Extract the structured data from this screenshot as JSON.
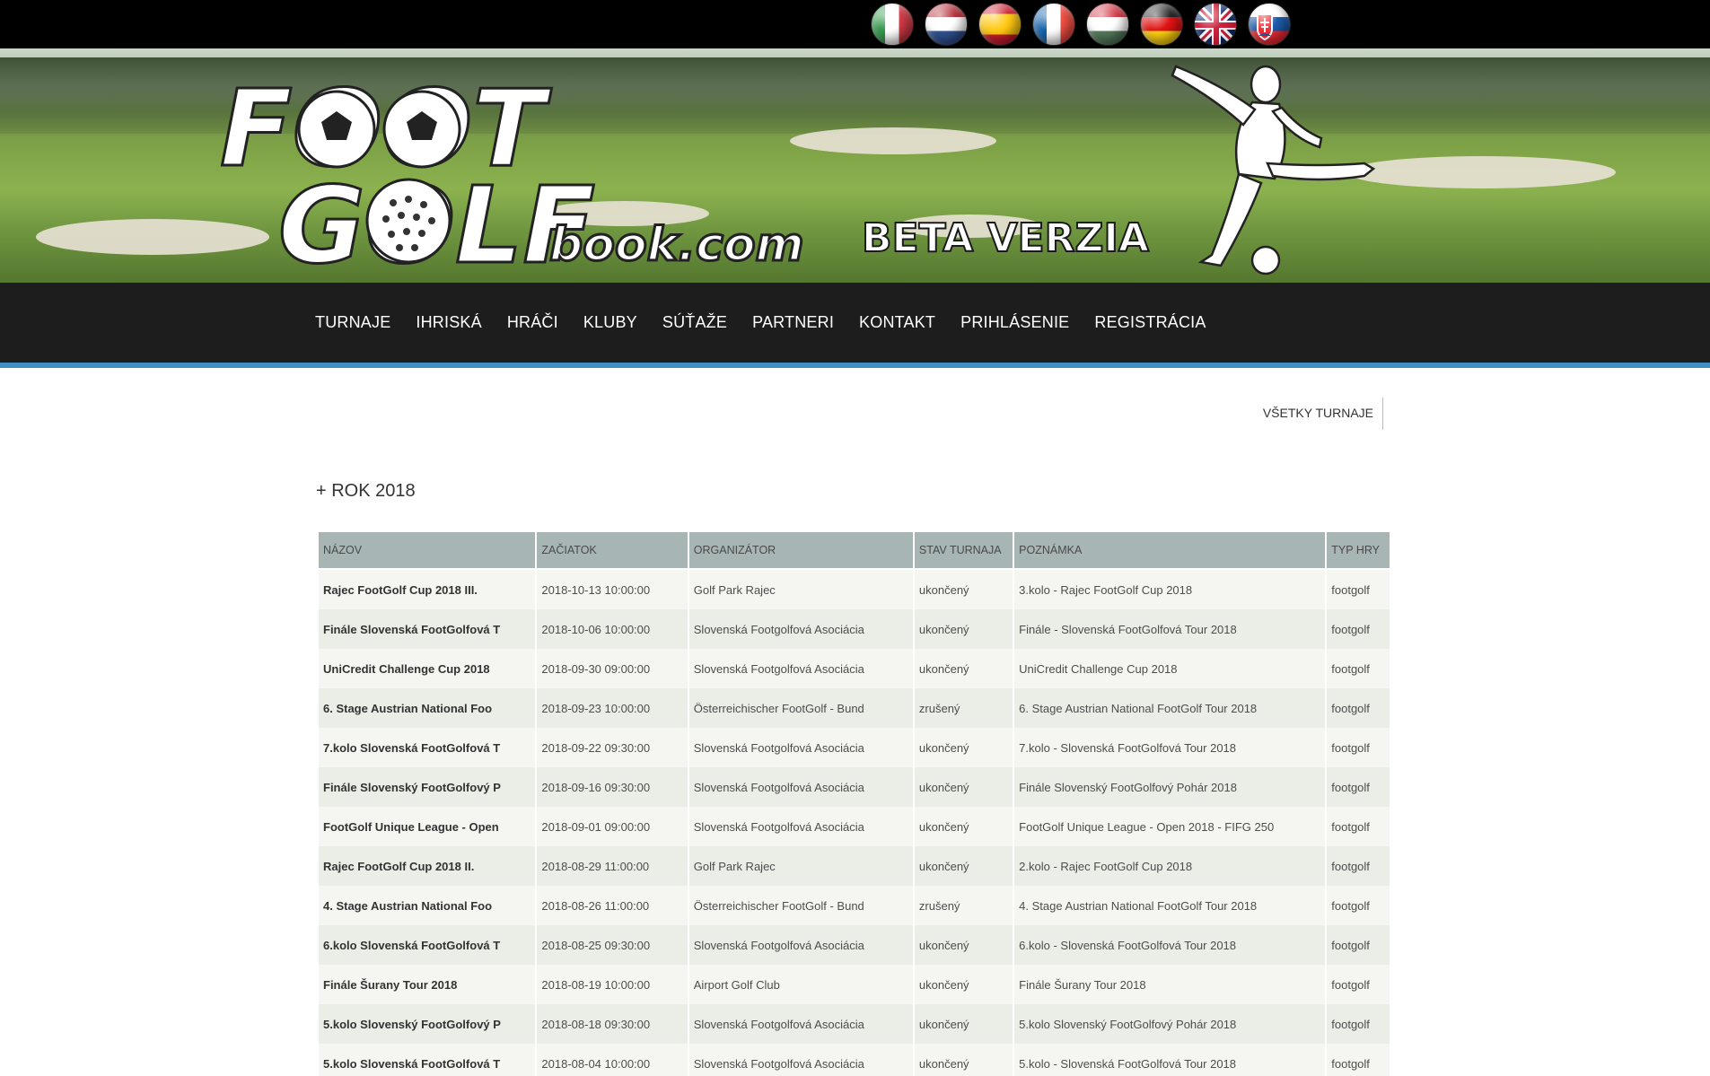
{
  "header": {
    "languages": [
      {
        "code": "it",
        "icon": "italy-flag-icon"
      },
      {
        "code": "nl",
        "icon": "netherlands-flag-icon"
      },
      {
        "code": "es",
        "icon": "spain-flag-icon"
      },
      {
        "code": "fr",
        "icon": "france-flag-icon"
      },
      {
        "code": "hu",
        "icon": "hungary-flag-icon"
      },
      {
        "code": "de",
        "icon": "germany-flag-icon"
      },
      {
        "code": "gb",
        "icon": "united-kingdom-flag-icon"
      },
      {
        "code": "sk",
        "icon": "slovakia-flag-icon"
      }
    ]
  },
  "banner": {
    "logo_top": "FOOT",
    "logo_bottom": "GOLF",
    "logo_domain": "book.com",
    "beta": "BETA VERZIA"
  },
  "nav": {
    "items": [
      "TURNAJE",
      "IHRISKÁ",
      "HRÁČI",
      "KLUBY",
      "SÚŤAŽE",
      "PARTNERI",
      "KONTAKT",
      "PRIHLÁSENIE",
      "REGISTRÁCIA"
    ]
  },
  "content": {
    "all_tournaments_link": "VŠETKY TURNAJE",
    "year_toggle": "+ ROK 2018",
    "table": {
      "headers": [
        "NÁZOV",
        "ZAČIATOK",
        "ORGANIZÁTOR",
        "STAV TURNAJA",
        "POZNÁMKA",
        "TYP HRY"
      ],
      "rows": [
        [
          "Rajec FootGolf Cup 2018 III.",
          "2018-10-13 10:00:00",
          "Golf Park Rajec",
          "ukončený",
          "3.kolo - Rajec FootGolf Cup 2018",
          "footgolf"
        ],
        [
          "Finále Slovenská FootGolfová T",
          "2018-10-06 10:00:00",
          "Slovenská Footgolfová Asociácia",
          "ukončený",
          "Finále - Slovenská FootGolfová Tour 2018",
          "footgolf"
        ],
        [
          "UniCredit Challenge Cup 2018",
          "2018-09-30 09:00:00",
          "Slovenská Footgolfová Asociácia",
          "ukončený",
          "UniCredit Challenge Cup 2018",
          "footgolf"
        ],
        [
          "6. Stage Austrian National Foo",
          "2018-09-23 10:00:00",
          "Österreichischer FootGolf - Bund",
          "zrušený",
          "6. Stage Austrian National FootGolf Tour 2018",
          "footgolf"
        ],
        [
          "7.kolo Slovenská FootGolfová T",
          "2018-09-22 09:30:00",
          "Slovenská Footgolfová Asociácia",
          "ukončený",
          "7.kolo - Slovenská FootGolfová Tour 2018",
          "footgolf"
        ],
        [
          "Finále Slovenský FootGolfový P",
          "2018-09-16 09:30:00",
          "Slovenská Footgolfová Asociácia",
          "ukončený",
          "Finále Slovenský FootGolfový Pohár 2018",
          "footgolf"
        ],
        [
          "FootGolf Unique League - Open",
          "2018-09-01 09:00:00",
          "Slovenská Footgolfová Asociácia",
          "ukončený",
          "FootGolf Unique League - Open 2018 - FIFG 250",
          "footgolf"
        ],
        [
          "Rajec FootGolf Cup 2018 II.",
          "2018-08-29 11:00:00",
          "Golf Park Rajec",
          "ukončený",
          "2.kolo - Rajec FootGolf Cup 2018",
          "footgolf"
        ],
        [
          "4. Stage Austrian National Foo",
          "2018-08-26 11:00:00",
          "Österreichischer FootGolf - Bund",
          "zrušený",
          "4. Stage Austrian National FootGolf Tour 2018",
          "footgolf"
        ],
        [
          "6.kolo Slovenská FootGolfová T",
          "2018-08-25 09:30:00",
          "Slovenská Footgolfová Asociácia",
          "ukončený",
          "6.kolo - Slovenská FootGolfová Tour 2018",
          "footgolf"
        ],
        [
          "Finále Šurany Tour 2018",
          "2018-08-19 10:00:00",
          "Airport Golf Club",
          "ukončený",
          "Finále Šurany Tour 2018",
          "footgolf"
        ],
        [
          "5.kolo Slovenský FootGolfový P",
          "2018-08-18 09:30:00",
          "Slovenská Footgolfová Asociácia",
          "ukončený",
          "5.kolo Slovenský FootGolfový Pohár 2018",
          "footgolf"
        ],
        [
          "5.kolo Slovenská FootGolfová T",
          "2018-08-04 10:00:00",
          "Slovenská Footgolfová Asociácia",
          "ukončený",
          "5.kolo - Slovenská FootGolfová Tour 2018",
          "footgolf"
        ]
      ]
    }
  }
}
